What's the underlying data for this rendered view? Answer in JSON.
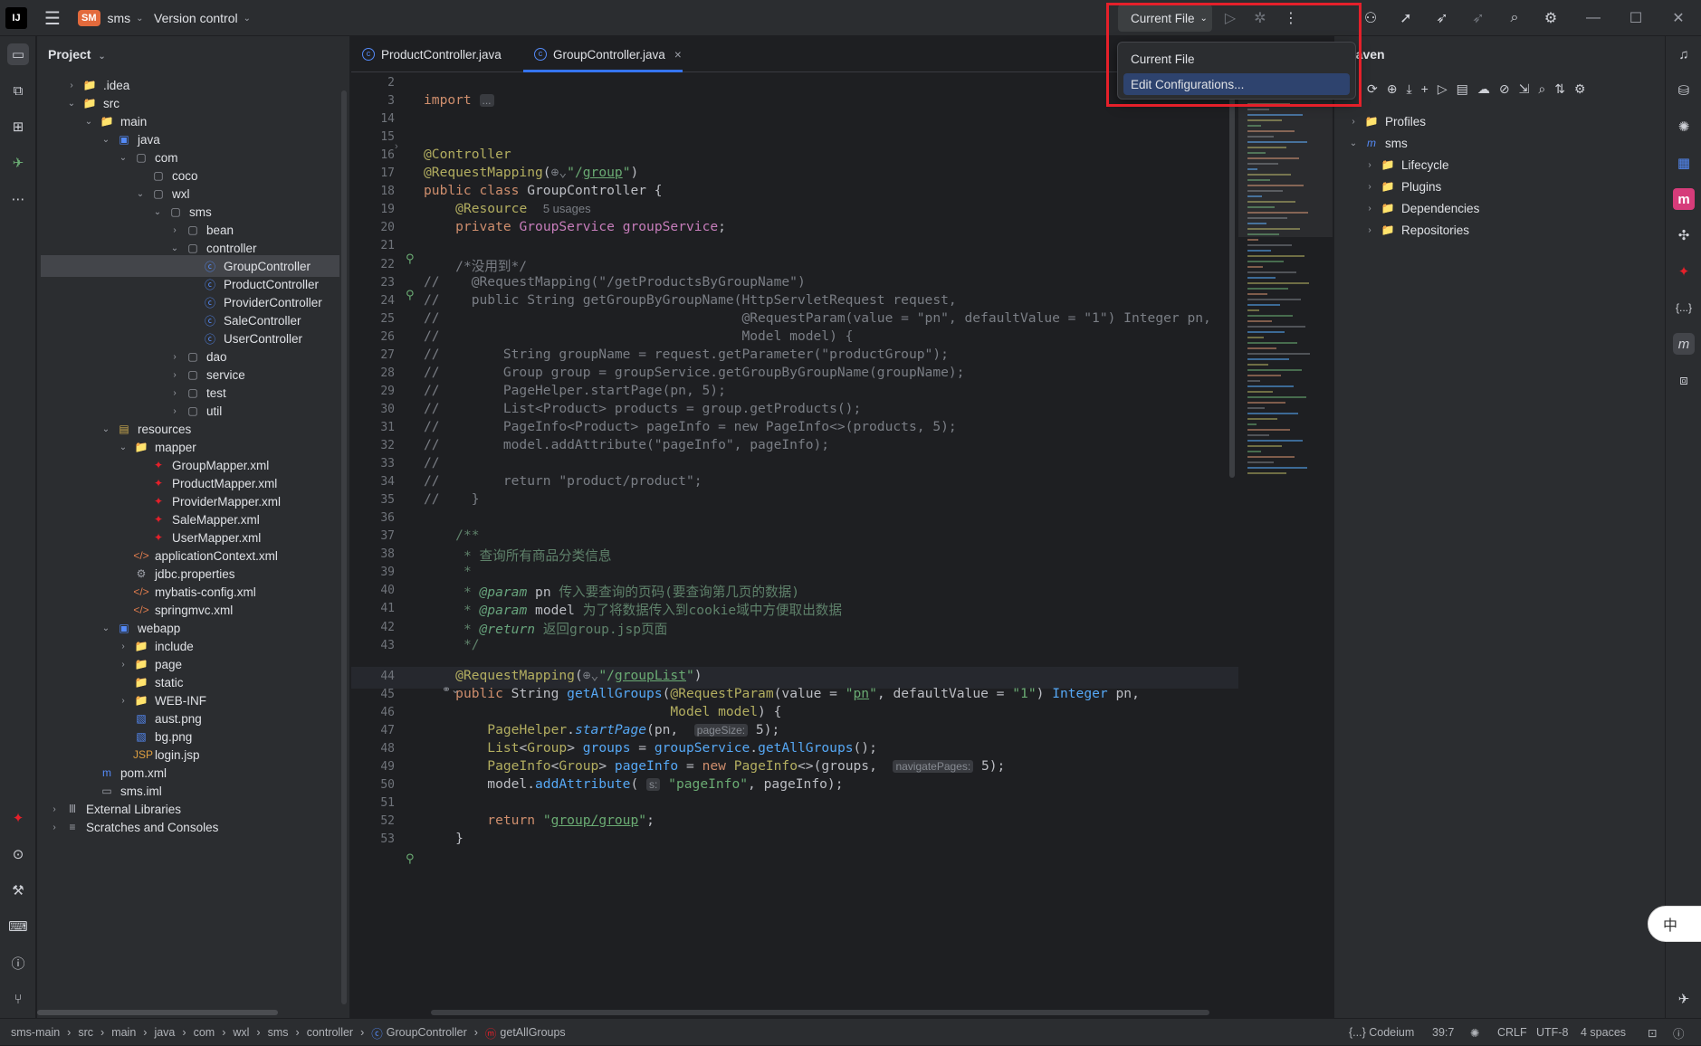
{
  "titlebar": {
    "project_badge": "SM",
    "project_name": "sms",
    "vcs": "Version control",
    "run_config": "Current File"
  },
  "popup": {
    "items": [
      "Current File",
      "Edit Configurations..."
    ],
    "selected": 1
  },
  "project_panel": {
    "title": "Project",
    "tree": [
      {
        "label": ".idea",
        "depth": 1,
        "arrow": "›",
        "icon": "folder"
      },
      {
        "label": "src",
        "depth": 1,
        "arrow": "⌄",
        "icon": "folder"
      },
      {
        "label": "main",
        "depth": 2,
        "arrow": "⌄",
        "icon": "folder"
      },
      {
        "label": "java",
        "depth": 3,
        "arrow": "⌄",
        "icon": "folder-src"
      },
      {
        "label": "com",
        "depth": 4,
        "arrow": "⌄",
        "icon": "package"
      },
      {
        "label": "coco",
        "depth": 5,
        "arrow": "",
        "icon": "package"
      },
      {
        "label": "wxl",
        "depth": 5,
        "arrow": "⌄",
        "icon": "package"
      },
      {
        "label": "sms",
        "depth": 6,
        "arrow": "⌄",
        "icon": "package"
      },
      {
        "label": "bean",
        "depth": 7,
        "arrow": "›",
        "icon": "package"
      },
      {
        "label": "controller",
        "depth": 7,
        "arrow": "⌄",
        "icon": "package"
      },
      {
        "label": "GroupController",
        "depth": 8,
        "arrow": "",
        "icon": "class",
        "selected": true
      },
      {
        "label": "ProductController",
        "depth": 8,
        "arrow": "",
        "icon": "class"
      },
      {
        "label": "ProviderController",
        "depth": 8,
        "arrow": "",
        "icon": "class"
      },
      {
        "label": "SaleController",
        "depth": 8,
        "arrow": "",
        "icon": "class"
      },
      {
        "label": "UserController",
        "depth": 8,
        "arrow": "",
        "icon": "class"
      },
      {
        "label": "dao",
        "depth": 7,
        "arrow": "›",
        "icon": "package"
      },
      {
        "label": "service",
        "depth": 7,
        "arrow": "›",
        "icon": "package"
      },
      {
        "label": "test",
        "depth": 7,
        "arrow": "›",
        "icon": "package"
      },
      {
        "label": "util",
        "depth": 7,
        "arrow": "›",
        "icon": "package"
      },
      {
        "label": "resources",
        "depth": 3,
        "arrow": "⌄",
        "icon": "folder-res"
      },
      {
        "label": "mapper",
        "depth": 4,
        "arrow": "⌄",
        "icon": "folder"
      },
      {
        "label": "GroupMapper.xml",
        "depth": 5,
        "arrow": "",
        "icon": "mybatis"
      },
      {
        "label": "ProductMapper.xml",
        "depth": 5,
        "arrow": "",
        "icon": "mybatis"
      },
      {
        "label": "ProviderMapper.xml",
        "depth": 5,
        "arrow": "",
        "icon": "mybatis"
      },
      {
        "label": "SaleMapper.xml",
        "depth": 5,
        "arrow": "",
        "icon": "mybatis"
      },
      {
        "label": "UserMapper.xml",
        "depth": 5,
        "arrow": "",
        "icon": "mybatis"
      },
      {
        "label": "applicationContext.xml",
        "depth": 4,
        "arrow": "",
        "icon": "xml"
      },
      {
        "label": "jdbc.properties",
        "depth": 4,
        "arrow": "",
        "icon": "props"
      },
      {
        "label": "mybatis-config.xml",
        "depth": 4,
        "arrow": "",
        "icon": "xml"
      },
      {
        "label": "springmvc.xml",
        "depth": 4,
        "arrow": "",
        "icon": "xml"
      },
      {
        "label": "webapp",
        "depth": 3,
        "arrow": "⌄",
        "icon": "folder-web"
      },
      {
        "label": "include",
        "depth": 4,
        "arrow": "›",
        "icon": "folder"
      },
      {
        "label": "page",
        "depth": 4,
        "arrow": "›",
        "icon": "folder"
      },
      {
        "label": "static",
        "depth": 4,
        "arrow": "",
        "icon": "folder"
      },
      {
        "label": "WEB-INF",
        "depth": 4,
        "arrow": "›",
        "icon": "folder"
      },
      {
        "label": "aust.png",
        "depth": 4,
        "arrow": "",
        "icon": "image"
      },
      {
        "label": "bg.png",
        "depth": 4,
        "arrow": "",
        "icon": "image"
      },
      {
        "label": "login.jsp",
        "depth": 4,
        "arrow": "",
        "icon": "jsp"
      },
      {
        "label": "pom.xml",
        "depth": 2,
        "arrow": "",
        "icon": "maven"
      },
      {
        "label": "sms.iml",
        "depth": 2,
        "arrow": "",
        "icon": "iml"
      },
      {
        "label": "External Libraries",
        "depth": 0,
        "arrow": "›",
        "icon": "libs"
      },
      {
        "label": "Scratches and Consoles",
        "depth": 0,
        "arrow": "›",
        "icon": "scratch"
      }
    ]
  },
  "editor": {
    "tabs": [
      {
        "label": "ProductController.java",
        "active": false
      },
      {
        "label": "GroupController.java",
        "active": true,
        "close": "×"
      }
    ],
    "line_numbers": [
      "2",
      "3",
      "14",
      "15",
      "16",
      "17",
      "18",
      "19",
      "20",
      "21",
      "22",
      "23",
      "24",
      "25",
      "26",
      "27",
      "28",
      "29",
      "30",
      "31",
      "32",
      "33",
      "34",
      "35",
      "36",
      "37",
      "38",
      "39",
      "40",
      "41",
      "42",
      "43",
      "44",
      "45",
      "46",
      "47",
      "48",
      "49",
      "50",
      "51",
      "52",
      "53"
    ],
    "lines": [
      {
        "t": ""
      },
      {
        "h": "<span class=\"kw\">import</span> <span class=\"hint\">...</span>"
      },
      {
        "t": ""
      },
      {
        "t": ""
      },
      {
        "h": "<span class=\"an\">@Controller</span>"
      },
      {
        "h": "<span class=\"an\">@RequestMapping</span>(<span class=\"cm\">⊕⌄</span><span class=\"st\">\"/<u>group</u>\"</span>)"
      },
      {
        "h": "<span class=\"kw\">public class</span> GroupController {"
      },
      {
        "h": "    <span class=\"an\">@Resource</span>  <span class=\"cm\" style=\"font-family:Liberation Sans,sans-serif;font-size:13px\">5 usages</span>"
      },
      {
        "h": "    <span class=\"kw\">private</span> <span style=\"color:#c77dbb\">GroupService</span> <span style=\"color:#c77dbb\">groupService</span>;"
      },
      {
        "t": ""
      },
      {
        "h": "    <span class=\"cm\">/*没用到*/</span>"
      },
      {
        "h": "<span class=\"cm\">//    @RequestMapping(\"/getProductsByGroupName\")</span>"
      },
      {
        "h": "<span class=\"cm\">//    public String getGroupByGroupName(HttpServletRequest request,</span>"
      },
      {
        "h": "<span class=\"cm\">//                                      @RequestParam(value = \"pn\", defaultValue = \"1\") Integer pn,</span>"
      },
      {
        "h": "<span class=\"cm\">//                                      Model model) {</span>"
      },
      {
        "h": "<span class=\"cm\">//        String groupName = request.getParameter(\"productGroup\");</span>"
      },
      {
        "h": "<span class=\"cm\">//        Group group = groupService.getGroupByGroupName(groupName);</span>"
      },
      {
        "h": "<span class=\"cm\">//        PageHelper.startPage(pn, 5);</span>"
      },
      {
        "h": "<span class=\"cm\">//        List&lt;Product&gt; products = group.getProducts();</span>"
      },
      {
        "h": "<span class=\"cm\">//        PageInfo&lt;Product&gt; pageInfo = new PageInfo&lt;&gt;(products, 5);</span>"
      },
      {
        "h": "<span class=\"cm\">//        model.addAttribute(\"pageInfo\", pageInfo);</span>"
      },
      {
        "h": "<span class=\"cm\">//</span>"
      },
      {
        "h": "<span class=\"cm\">//        return \"product/product\";</span>"
      },
      {
        "h": "<span class=\"cm\">//    }</span>"
      },
      {
        "t": ""
      },
      {
        "h": "    <span class=\"doc\">/**</span>"
      },
      {
        "h": "    <span class=\"doc\"> * 查询所有商品分类信息</span>"
      },
      {
        "h": "    <span class=\"doc\"> *</span>"
      },
      {
        "h": "    <span class=\"doc\"> * <span class=\"tag\">@param</span> <span style=\"color:#bcbec4\">pn</span> 传入要查询的页码(要查询第几页的数据)</span>"
      },
      {
        "h": "    <span class=\"doc\"> * <span class=\"tag\">@param</span> <span style=\"color:#bcbec4\">model</span> 为了将数据传入到cookie域中方便取出数据</span>"
      },
      {
        "h": "    <span class=\"doc\"> * <span class=\"tag\">@return</span> 返回group.jsp页面</span>"
      },
      {
        "h": "    <span class=\"doc\"> */</span>"
      },
      {
        "h": "    <span class=\"an\">@RequestMapping</span>(<span class=\"cm\">⊕⌄</span><span class=\"st\">\"/<u>groupList</u>\"</span>)"
      },
      {
        "h": "    <span class=\"kw\">public</span> String <span class=\"fn\">getAllGroups</span>(<span class=\"an\">@RequestParam</span>(value = <span class=\"st\">\"<u>pn</u>\"</span>, defaultValue = <span class=\"st\">\"1\"</span>) <span class=\"kw\" style=\"color:#56a8f5\">Integer</span> pn,"
      },
      {
        "h": "                               <span class=\"an\">Model</span> <span class=\"an\">model</span>) {"
      },
      {
        "h": "        <span class=\"an\">PageHelper</span>.<span class=\"fn\" style=\"font-style:italic\">startPage</span>(pn,  <span class=\"hint\">pageSize:</span> 5);"
      },
      {
        "h": "        <span class=\"an\">List</span>&lt;<span class=\"an\">Group</span>&gt; <span class=\"fn\">groups</span> = <span class=\"fn\">groupService</span>.<span class=\"fn\">getAllGroups</span>();"
      },
      {
        "h": "        <span class=\"an\">PageInfo</span>&lt;<span class=\"an\">Group</span>&gt; <span class=\"fn\">pageInfo</span> = <span class=\"kw\">new</span> <span class=\"an\">PageInfo</span>&lt;&gt;(groups,  <span class=\"hint\">navigatePages:</span> 5);"
      },
      {
        "h": "        model.<span class=\"fn\">addAttribute</span>( <span class=\"hint\">s:</span> <span class=\"st\">\"pageInfo\"</span>, pageInfo);"
      },
      {
        "t": ""
      },
      {
        "h": "        <span class=\"kw\">return</span> <span class=\"st\">\"<u>group/group</u>\"</span>;"
      },
      {
        "h": "    }"
      }
    ]
  },
  "maven": {
    "title": "Maven",
    "tree": [
      {
        "label": "Profiles",
        "depth": 0,
        "arrow": "›",
        "icon": "folder"
      },
      {
        "label": "sms",
        "depth": 0,
        "arrow": "⌄",
        "icon": "maven"
      },
      {
        "label": "Lifecycle",
        "depth": 1,
        "arrow": "›",
        "icon": "folder"
      },
      {
        "label": "Plugins",
        "depth": 1,
        "arrow": "›",
        "icon": "folder"
      },
      {
        "label": "Dependencies",
        "depth": 1,
        "arrow": "›",
        "icon": "folder"
      },
      {
        "label": "Repositories",
        "depth": 1,
        "arrow": "›",
        "icon": "folder"
      }
    ]
  },
  "statusbar": {
    "breadcrumbs": [
      "sms-main",
      "src",
      "main",
      "java",
      "com",
      "wxl",
      "sms",
      "controller",
      "GroupController",
      "getAllGroups"
    ],
    "codeium": "{...} Codeium",
    "position": "39:7",
    "line_sep": "CRLF",
    "encoding": "UTF-8",
    "indent": "4 spaces"
  },
  "ime": {
    "label": "中"
  }
}
